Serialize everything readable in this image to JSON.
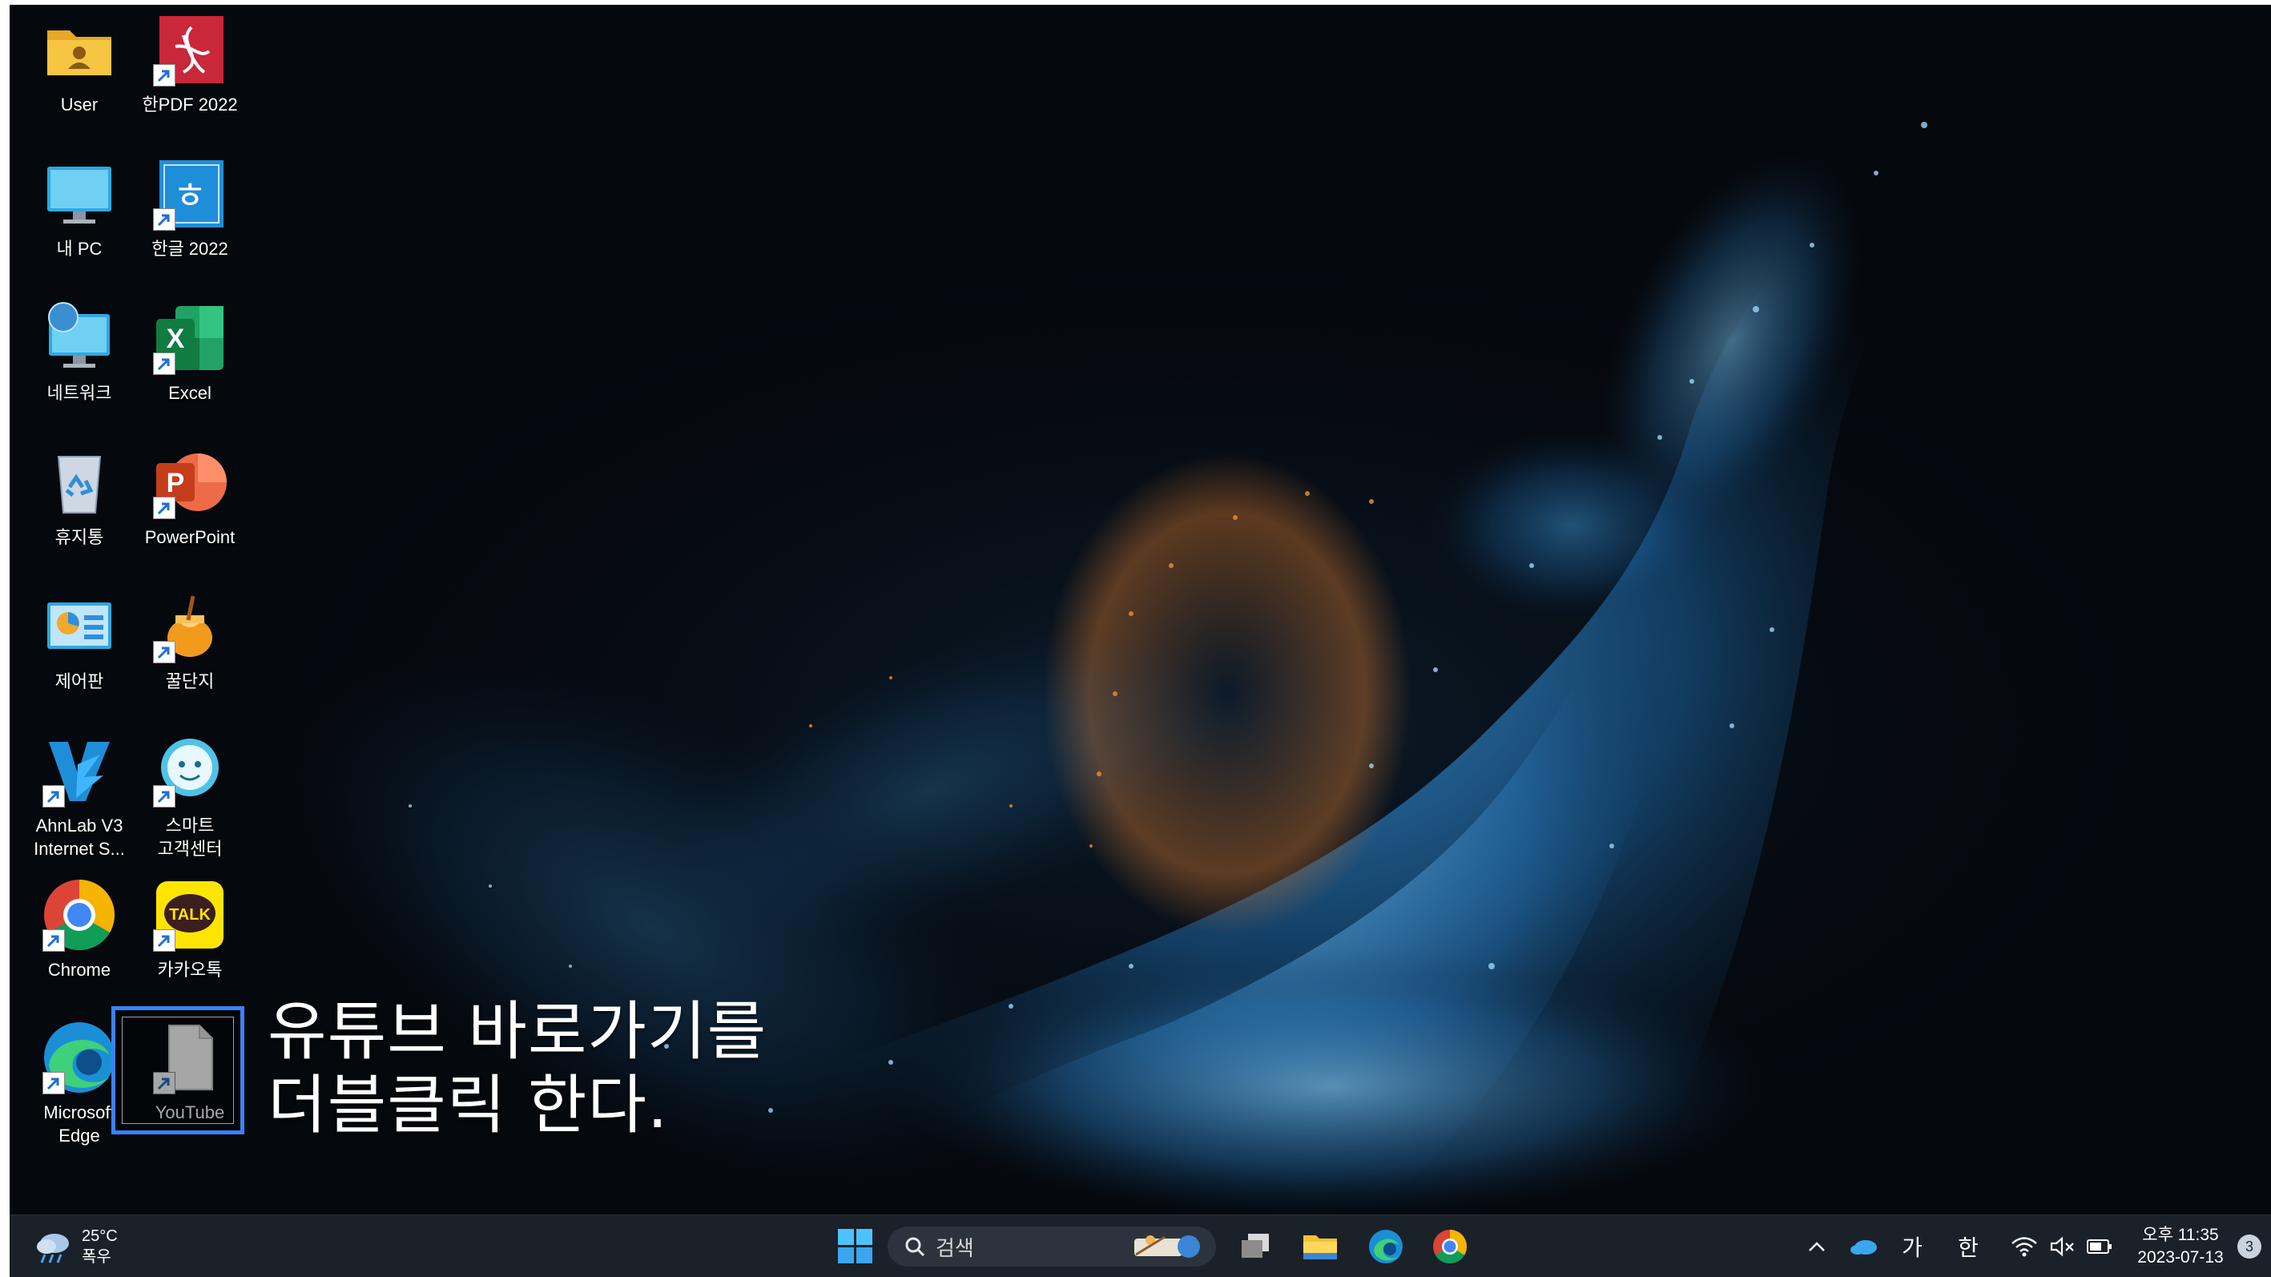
{
  "desktop": {
    "icons": [
      {
        "label": "User",
        "icon": "user-folder-icon"
      },
      {
        "label": "한PDF 2022",
        "icon": "hanpdf-icon"
      },
      {
        "label": "내 PC",
        "icon": "this-pc-icon"
      },
      {
        "label": "한글 2022",
        "icon": "hangul-icon"
      },
      {
        "label": "네트워크",
        "icon": "network-icon"
      },
      {
        "label": "Excel",
        "icon": "excel-icon"
      },
      {
        "label": "휴지통",
        "icon": "recycle-bin-icon"
      },
      {
        "label": "PowerPoint",
        "icon": "powerpoint-icon"
      },
      {
        "label": "제어판",
        "icon": "control-panel-icon"
      },
      {
        "label": "꿀단지",
        "icon": "honey-pot-icon"
      },
      {
        "label": "AhnLab V3\nInternet S...",
        "icon": "ahnlab-v3-icon"
      },
      {
        "label": "스마트\n고객센터",
        "icon": "smart-support-icon"
      },
      {
        "label": "Chrome",
        "icon": "chrome-icon"
      },
      {
        "label": "카카오톡",
        "icon": "kakaotalk-icon"
      },
      {
        "label": "Microsoft\nEdge",
        "icon": "edge-icon"
      },
      {
        "label": "YouTube",
        "icon": "file-shortcut-icon"
      }
    ],
    "kakao_badge": "TALK",
    "excel_letter": "X",
    "ppt_letter": "P"
  },
  "annotation": {
    "line1": "유튜브 바로가기를",
    "line2": "더블클릭 한다."
  },
  "taskbar": {
    "weather_temp": "25°C",
    "weather_desc": "폭우",
    "search_placeholder": "검색",
    "tray_input_mode": "가",
    "tray_ime": "한",
    "clock_time": "오후 11:35",
    "clock_date": "2023-07-13",
    "notification_count": "3"
  },
  "colors": {
    "selection": "#3b82f6",
    "taskbar_bg": "#1b2129",
    "desktop_bg": "#05080d"
  }
}
